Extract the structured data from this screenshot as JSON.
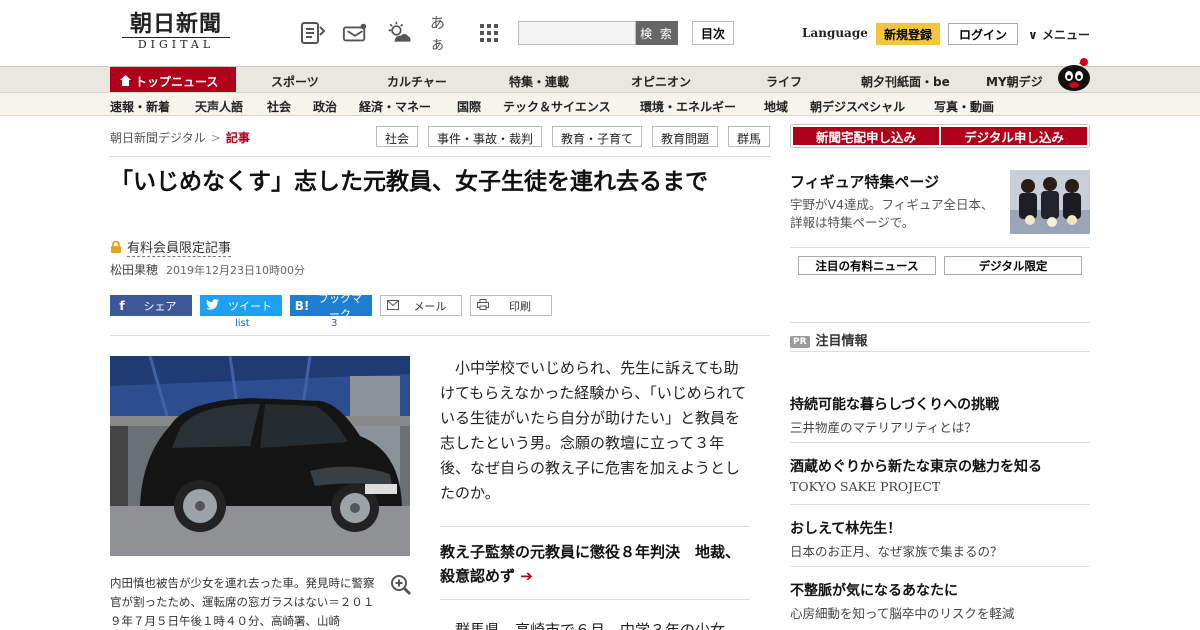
{
  "header": {
    "logo_main": "朝日新聞",
    "logo_sub": "DIGITAL",
    "search_button": "検 索",
    "toc_button": "目次",
    "language": "Language",
    "register": "新規登録",
    "login": "ログイン",
    "menu": "メニュー",
    "font_size_glyph": "あぁ"
  },
  "nav_primary": [
    "トップニュース",
    "スポーツ",
    "カルチャー",
    "特集・連載",
    "オピニオン",
    "ライフ",
    "朝夕刊紙面・be",
    "MY朝デジ"
  ],
  "nav_secondary": [
    "速報・新着",
    "天声人語",
    "社会",
    "政治",
    "経済・マネー",
    "国際",
    "テック＆サイエンス",
    "環境・エネルギー",
    "地域",
    "朝デジスペシャル",
    "写真・動画"
  ],
  "breadcrumb": {
    "home": "朝日新聞デジタル",
    "sep": ">",
    "current": "記事"
  },
  "tags": [
    "社会",
    "事件・事故・裁判",
    "教育・子育て",
    "教育問題",
    "群馬"
  ],
  "article": {
    "title": "「いじめなくす」志した元教員、女子生徒を連れ去るまで",
    "premium_label": "有料会員限定記事",
    "author": "松田果穂",
    "date": "2019年12月23日10時00分",
    "lead": "小中学校でいじめられ、先生に訴えても助けてもらえなかった経験から、「いじめられている生徒がいたら自分が助けたい」と教員を志したという男。念願の教壇に立って３年後、なぜ自らの教え子に危害を加えようとしたのか。",
    "related": "教え子監禁の元教員に懲役８年判決　地裁、殺意認めず",
    "related_arrow": "➔",
    "body_start": "群馬県　高崎市で６月、中学３年の少女",
    "caption": "内田慎也被告が少女を連れ去った車。発見時に警察官が割ったため、運転席の窓ガラスはない＝２０１９年７月５日午後１時４０分、高崎署、山崎"
  },
  "share": {
    "facebook": "シェア",
    "twitter": "ツイート",
    "hatena": "ブックマーク",
    "hatena_icon": "B!",
    "mail": "メール",
    "print": "印刷",
    "twitter_count": "list",
    "hatena_count": "3"
  },
  "sidebar": {
    "cta_paper": "新聞宅配申し込み",
    "cta_digital": "デジタル申し込み",
    "feature_title": "フィギュア特集ページ",
    "feature_desc": "宇野がV4達成。フィギュア全日本、詳報は特集ページで。",
    "tab_premium": "注目の有料ニュース",
    "tab_digital": "デジタル限定",
    "pr_badge": "PR",
    "pr_heading": "注目情報",
    "pr_items": [
      {
        "title": "持続可能な暮らしづくりへの挑戦",
        "sub": "三井物産のマテリアリティとは？"
      },
      {
        "title": "酒蔵めぐりから新たな東京の魅力を知る",
        "sub": "TOKYO SAKE PROJECT"
      },
      {
        "title": "おしえて林先生！",
        "sub": "日本のお正月、なぜ家族で集まるの？"
      },
      {
        "title": "不整脈が気になるあなたに",
        "sub": "心房細動を知って脳卒中のリスクを軽減"
      }
    ]
  },
  "colors": {
    "brand_red": "#b1001c",
    "register_yellow": "#f4c542",
    "facebook": "#3b5998",
    "twitter": "#1da1f2",
    "hatena": "#1e7fd1"
  }
}
